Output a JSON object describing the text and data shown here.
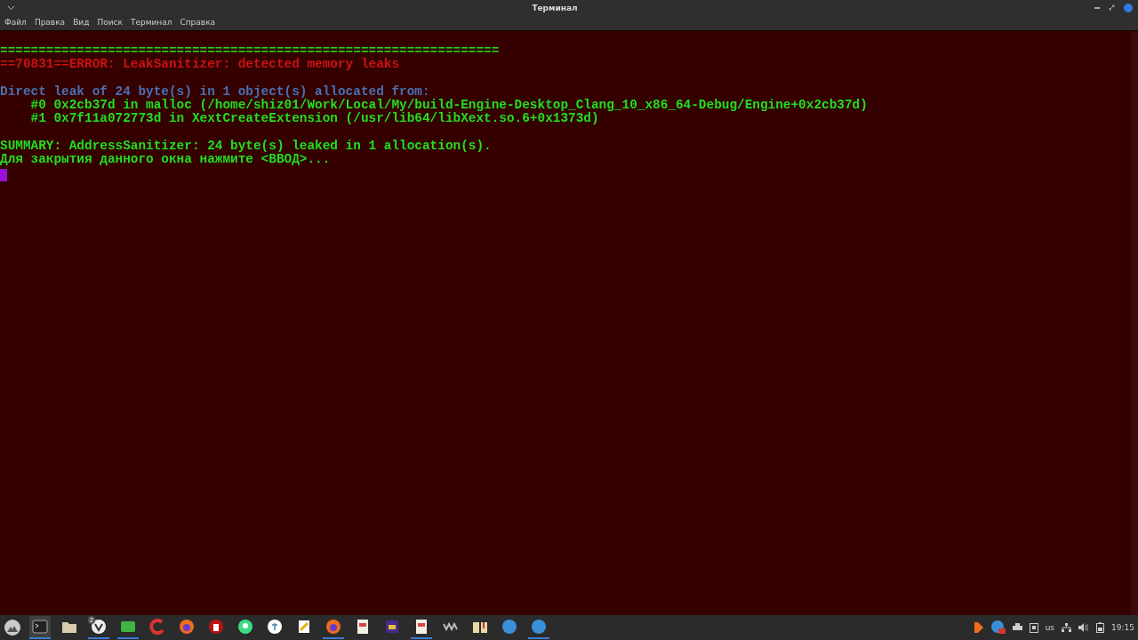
{
  "window": {
    "title": "Терминал"
  },
  "menu": [
    "Файл",
    "Правка",
    "Вид",
    "Поиск",
    "Терминал",
    "Справка"
  ],
  "terminal": {
    "lines": [
      {
        "kind": "text",
        "text": "=================================================================",
        "color": "#22dd22"
      },
      {
        "kind": "text",
        "text": "==70831==ERROR: LeakSanitizer: detected memory leaks",
        "color": "#cc1111"
      },
      {
        "kind": "blank"
      },
      {
        "kind": "text",
        "text": "Direct leak of 24 byte(s) in 1 object(s) allocated from:",
        "color": "#4a6fb0"
      },
      {
        "kind": "text",
        "text": "    #0 0x2cb37d in malloc (/home/shiz01/Work/Local/My/build-Engine-Desktop_Clang_10_x86_64-Debug/Engine+0x2cb37d)",
        "color": "#22dd22"
      },
      {
        "kind": "text",
        "text": "    #1 0x7f11a072773d in XextCreateExtension (/usr/lib64/libXext.so.6+0x1373d)",
        "color": "#22dd22"
      },
      {
        "kind": "blank"
      },
      {
        "kind": "text",
        "text": "SUMMARY: AddressSanitizer: 24 byte(s) leaked in 1 allocation(s).",
        "color": "#22dd22"
      },
      {
        "kind": "text",
        "text": "Для закрытия данного окна нажмите <ВВОД>...",
        "color": "#22dd22"
      }
    ]
  },
  "taskbar": {
    "apps": [
      {
        "kind": "terminal",
        "running": true,
        "selected": true
      },
      {
        "kind": "folder",
        "running": false,
        "selected": false
      },
      {
        "kind": "browser",
        "running": true,
        "selected": false,
        "badge": "2"
      },
      {
        "kind": "green",
        "running": true,
        "selected": false
      },
      {
        "kind": "red",
        "running": false,
        "selected": false
      },
      {
        "kind": "orange",
        "running": false,
        "selected": false
      },
      {
        "kind": "redcircle",
        "running": false,
        "selected": false
      },
      {
        "kind": "android",
        "running": false,
        "selected": false
      },
      {
        "kind": "whitecircle",
        "running": false,
        "selected": false
      },
      {
        "kind": "note",
        "running": false,
        "selected": false
      },
      {
        "kind": "orange",
        "running": true,
        "selected": false
      },
      {
        "kind": "paper",
        "running": false,
        "selected": false
      },
      {
        "kind": "purple",
        "running": false,
        "selected": false
      },
      {
        "kind": "paper",
        "running": true,
        "selected": false
      },
      {
        "kind": "grey",
        "running": false,
        "selected": false
      },
      {
        "kind": "book",
        "running": false,
        "selected": false
      },
      {
        "kind": "bluecircle",
        "running": false,
        "selected": false
      },
      {
        "kind": "bluecircle",
        "running": true,
        "selected": false
      }
    ],
    "keyboard_layout": "us",
    "clock": "19:15"
  }
}
